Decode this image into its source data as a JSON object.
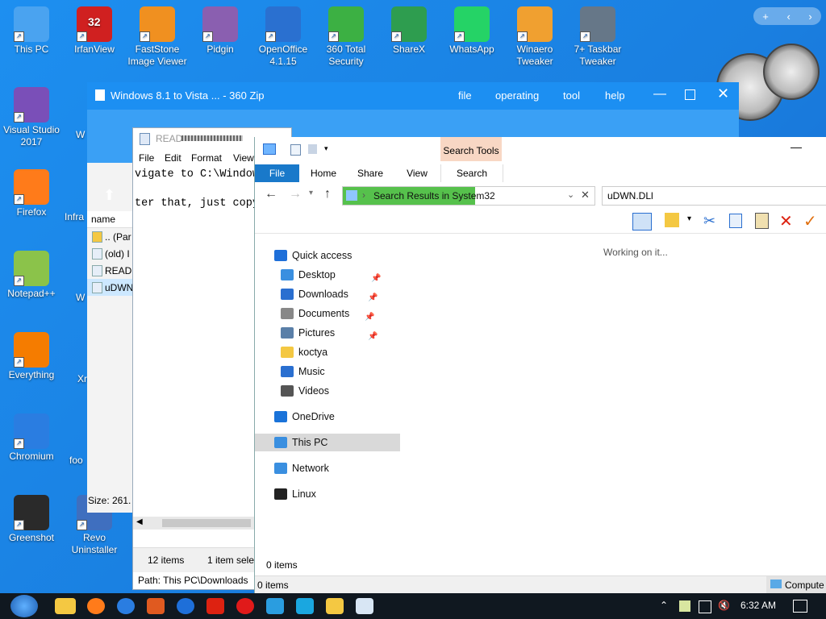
{
  "desktop": {
    "icons": [
      {
        "label": "This PC",
        "color": "#4aa3f0"
      },
      {
        "label": "IrfanView",
        "color": "#d02020",
        "badge": "32"
      },
      {
        "label": "FastStone Image Viewer",
        "color": "#f09020"
      },
      {
        "label": "Pidgin",
        "color": "#8a5fb0"
      },
      {
        "label": "OpenOffice 4.1.15",
        "color": "#2a70d0"
      },
      {
        "label": "360 Total Security",
        "color": "#3cb043"
      },
      {
        "label": "ShareX",
        "color": "#2e9d4f"
      },
      {
        "label": "WhatsApp",
        "color": "#25d366"
      },
      {
        "label": "Winaero Tweaker",
        "color": "#f0a030"
      },
      {
        "label": "7+ Taskbar Tweaker",
        "color": "#667788"
      },
      {
        "label": "Visual Studio 2017",
        "color": "#7a4fb8"
      },
      {
        "label": "Firefox",
        "color": "#ff7b1a"
      },
      {
        "label": "Notepad++",
        "color": "#8bc34a"
      },
      {
        "label": "Everything",
        "color": "#f57c00"
      },
      {
        "label": "Chromium",
        "color": "#2a7de1"
      },
      {
        "label": "Greenshot",
        "color": "#2a2a2a"
      },
      {
        "label": "Revo Uninstaller",
        "color": "#3f6fbf"
      }
    ],
    "partial_labels": [
      "W",
      "Infra",
      "W",
      "Xr",
      "foo"
    ]
  },
  "zip_window": {
    "title": "Windows 8.1 to Vista ... - 360 Zip",
    "menu": [
      "file",
      "operating",
      "tool",
      "help"
    ],
    "column_header": "name",
    "files": [
      ".. (Par",
      "(old) I",
      "READI",
      "uDWN"
    ],
    "size": "Size: 261."
  },
  "notepad": {
    "title": "READ",
    "menu": [
      "File",
      "Edit",
      "Format",
      "View"
    ],
    "lines": [
      "vigate to C:\\Window",
      "ter that, just copy"
    ],
    "status_left": "12 items",
    "status_right": "1 item select",
    "path": "Path: This PC\\Downloads"
  },
  "explorer": {
    "context_tab": "Search Tools",
    "tabs": [
      "File",
      "Home",
      "Share",
      "View",
      "Search"
    ],
    "address": "Search Results in System32",
    "search_value": "uDWN.DLl",
    "status_msg": "Working on it...",
    "nav": [
      {
        "label": "Quick access",
        "color": "#1e6fd9"
      },
      {
        "label": "Desktop",
        "color": "#3a8fe0",
        "pin": true
      },
      {
        "label": "Downloads",
        "color": "#2a6fd0",
        "pin": true
      },
      {
        "label": "Documents",
        "color": "#888888",
        "pin": true
      },
      {
        "label": "Pictures",
        "color": "#5a7fa8",
        "pin": true
      },
      {
        "label": "koctya",
        "color": "#f4c842"
      },
      {
        "label": "Music",
        "color": "#2a6fd0"
      },
      {
        "label": "Videos",
        "color": "#555555"
      },
      {
        "label": "OneDrive",
        "color": "#1a73d9"
      },
      {
        "label": "This PC",
        "color": "#3a8fe0"
      },
      {
        "label": "Network",
        "color": "#3a8fe0"
      },
      {
        "label": "Linux",
        "color": "#222222"
      }
    ],
    "item_count": "0 items",
    "item_count_bottom": "0 items",
    "computer_label": "Compute"
  },
  "taskbar": {
    "time": "6:32 AM"
  }
}
